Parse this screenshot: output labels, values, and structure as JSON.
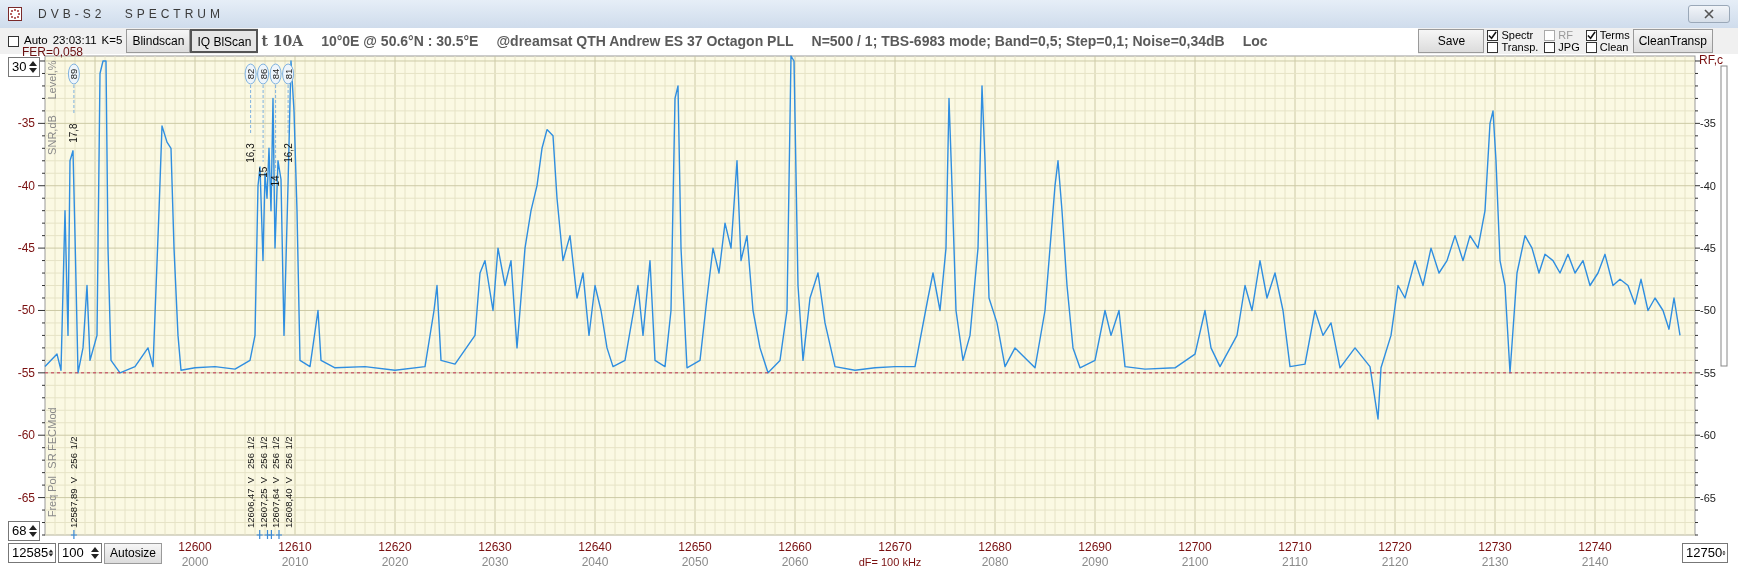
{
  "window": {
    "title": "DVB-S2 SPECTRUM"
  },
  "toolbar": {
    "auto": {
      "label": "Auto",
      "checked": false
    },
    "clock": "23:03:11",
    "k": "K=5",
    "buttons": [
      {
        "label": "Blindscan",
        "default": false
      },
      {
        "label": "IQ BlScan",
        "default": true
      }
    ],
    "info": [
      "t 10A",
      "10°0E  @  50.6°N : 30.5°E",
      "@dreamsat QTH Andrew ES 37 Octagon PLL",
      "N=500 / 1; TBS-6983 mode; Band=0,5; Step=0,1; Noise=0,34dB",
      "Loc"
    ],
    "save": "Save",
    "options": [
      {
        "label": "Spectr",
        "checked": true,
        "disabled": false
      },
      {
        "label": "Transp.",
        "checked": false,
        "disabled": false
      },
      {
        "label": "RF",
        "checked": false,
        "disabled": true
      },
      {
        "label": "JPG",
        "checked": false,
        "disabled": false
      },
      {
        "label": "Terms",
        "checked": true,
        "disabled": false
      },
      {
        "label": "Clean",
        "checked": false,
        "disabled": false
      }
    ],
    "clean_button": "CleanTransp"
  },
  "fer": "FER=0,058",
  "controls": {
    "top_level": "30",
    "bottom_level": "68",
    "start": "12585",
    "span": "100",
    "autosize": "Autosize",
    "end": "12750"
  },
  "chart": {
    "left_captions_top": [
      "Level,%",
      "SNR,dB"
    ],
    "left_captions_bottom": [
      "Mod",
      "FEC",
      "SR",
      "Pol",
      "Freq"
    ],
    "right_caption": "RF,c",
    "right_labels": [
      "-35",
      "-40",
      "-45",
      "-50",
      "-55",
      "-60",
      "-65"
    ],
    "if_row": [
      {
        "text": "2000",
        "kind": "if"
      },
      {
        "text": "2010",
        "kind": "if"
      },
      {
        "text": "2020",
        "kind": "if"
      },
      {
        "text": "2030",
        "kind": "if"
      },
      {
        "text": "2040",
        "kind": "if"
      },
      {
        "text": "2050",
        "kind": "if"
      },
      {
        "text": "2060",
        "kind": "if"
      },
      {
        "text": "dF= 100 kHz",
        "kind": "step"
      },
      {
        "text": "2080",
        "kind": "if"
      },
      {
        "text": "2090",
        "kind": "if"
      },
      {
        "text": "2100",
        "kind": "if"
      },
      {
        "text": "2110",
        "kind": "if"
      },
      {
        "text": "2120",
        "kind": "if"
      },
      {
        "text": "2130",
        "kind": "if"
      },
      {
        "text": "2140",
        "kind": "if"
      }
    ],
    "chart_data": {
      "type": "line",
      "xlim": [
        12585,
        12750
      ],
      "ylim": [
        -68,
        -29.6
      ],
      "grid": true,
      "xticks": [
        12600,
        12610,
        12620,
        12630,
        12640,
        12650,
        12660,
        12670,
        12680,
        12690,
        12700,
        12710,
        12720,
        12730,
        12740
      ],
      "yticks": [
        {
          "value": -35,
          "label": "-35"
        },
        {
          "value": -40,
          "label": "-40"
        },
        {
          "value": -45,
          "label": "-45"
        },
        {
          "value": -50,
          "label": "-50"
        },
        {
          "value": -55,
          "label": "-55"
        },
        {
          "value": -60,
          "label": "-60"
        },
        {
          "value": -65,
          "label": "-65"
        }
      ],
      "x": [
        12585,
        12586.2,
        12586.6,
        12587,
        12587.3,
        12587.5,
        12587.8,
        12588,
        12588.3,
        12588.8,
        12589.2,
        12589.5,
        12590.2,
        12590.5,
        12590.8,
        12591.1,
        12591.3,
        12591.6,
        12592.5,
        12594,
        12595.3,
        12595.8,
        12596.4,
        12596.7,
        12597.2,
        12597.6,
        12597.9,
        12598.3,
        12598.6,
        12600,
        12602,
        12604,
        12605.5,
        12606,
        12606.3,
        12606.5,
        12606.8,
        12607,
        12607.2,
        12607.4,
        12607.6,
        12607.8,
        12608,
        12608.3,
        12608.6,
        12608.9,
        12609.3,
        12609.6,
        12609.9,
        12610.2,
        12610.5,
        12611.5,
        12612.3,
        12612.6,
        12614,
        12617,
        12620,
        12623,
        12623.9,
        12624.2,
        12624.6,
        12626,
        12628,
        12628.5,
        12629,
        12629.8,
        12630.3,
        12631,
        12631.6,
        12632.2,
        12633,
        12633.6,
        12634.2,
        12634.7,
        12635.2,
        12635.8,
        12636.2,
        12636.8,
        12637.5,
        12638.2,
        12638.8,
        12639.4,
        12640,
        12640.6,
        12641.2,
        12641.8,
        12643,
        12644.3,
        12644.8,
        12645.5,
        12646,
        12647,
        12647.6,
        12648,
        12648.3,
        12648.6,
        12649.2,
        12650.5,
        12651.2,
        12651.8,
        12652.4,
        12653,
        12653.6,
        12654.2,
        12654.6,
        12655.2,
        12655.8,
        12656.5,
        12657.3,
        12658.5,
        12659.2,
        12659.6,
        12659.9,
        12660.3,
        12660.8,
        12661.5,
        12662.3,
        12663,
        12664,
        12666,
        12668,
        12670,
        12672,
        12673.3,
        12673.8,
        12674.5,
        12675.1,
        12675.4,
        12675.7,
        12676.1,
        12676.8,
        12677.5,
        12678.3,
        12678.7,
        12679,
        12679.4,
        12680.2,
        12681,
        12682,
        12684,
        12685,
        12685.6,
        12686,
        12686.3,
        12686.7,
        12687.2,
        12687.8,
        12688.5,
        12690,
        12691,
        12691.6,
        12692.4,
        12693,
        12695,
        12698,
        12700,
        12701,
        12701.6,
        12702.5,
        12704.2,
        12705,
        12705.7,
        12706.5,
        12707.2,
        12708,
        12708.8,
        12709.5,
        12711,
        12712,
        12712.8,
        12713.6,
        12714.5,
        12716,
        12717.5,
        12718.3,
        12718.6,
        12719.6,
        12720.3,
        12721,
        12722,
        12722.8,
        12723.6,
        12724.4,
        12725.2,
        12726,
        12726.8,
        12727.5,
        12728.3,
        12729,
        12729.5,
        12729.8,
        12730.1,
        12730.5,
        12731,
        12731.5,
        12732.2,
        12733,
        12733.7,
        12734.4,
        12735,
        12735.8,
        12736.5,
        12737.3,
        12738,
        12738.8,
        12739.5,
        12740.3,
        12741,
        12741.8,
        12742.5,
        12743.3,
        12744,
        12744.6,
        12745.3,
        12746,
        12746.8,
        12747.4,
        12747.9,
        12748.5
      ],
      "series": [
        {
          "color": "#2f8ee0",
          "values": [
            -54.5,
            -53.5,
            -54.8,
            -42,
            -52,
            -38,
            -37.2,
            -44,
            -55,
            -53,
            -48,
            -54,
            -52,
            -31,
            -30,
            -30,
            -45,
            -54,
            -55,
            -54.5,
            -53,
            -54.5,
            -42,
            -35.2,
            -36.5,
            -37,
            -45,
            -52,
            -54.8,
            -54.6,
            -54.5,
            -54.7,
            -54,
            -52,
            -40,
            -38.5,
            -46,
            -39,
            -41,
            -37,
            -42,
            -33,
            -45,
            -38,
            -39.5,
            -52,
            -40,
            -30,
            -34,
            -42,
            -54,
            -54.5,
            -50,
            -54,
            -54.6,
            -54.5,
            -54.8,
            -54.5,
            -50,
            -48,
            -54,
            -54.3,
            -52,
            -47,
            -46,
            -50,
            -45,
            -48,
            -46,
            -53,
            -45,
            -42,
            -40,
            -37,
            -35.5,
            -36,
            -41,
            -46,
            -44,
            -49,
            -47,
            -52,
            -48,
            -50,
            -53,
            -54.5,
            -54,
            -48,
            -52,
            -46,
            -54,
            -54.5,
            -50,
            -33,
            -32,
            -45,
            -54.6,
            -54,
            -49,
            -45,
            -47,
            -43,
            -45,
            -38,
            -46,
            -44,
            -50,
            -53,
            -55,
            -54,
            -50,
            -29.6,
            -30,
            -48,
            -54,
            -49,
            -47,
            -51,
            -54.5,
            -54.8,
            -54.6,
            -54.5,
            -54.5,
            -49,
            -47,
            -50,
            -45,
            -33,
            -40,
            -50,
            -54,
            -52,
            -45,
            -32,
            -38,
            -49,
            -51,
            -54.5,
            -53,
            -54.6,
            -50,
            -44,
            -40,
            -38,
            -42,
            -48,
            -53,
            -54.6,
            -54,
            -50,
            -52,
            -50,
            -54.5,
            -54.7,
            -54.6,
            -53.5,
            -50,
            -53,
            -54.5,
            -52,
            -48,
            -50,
            -46,
            -49,
            -47,
            -50,
            -54.5,
            -54.3,
            -50,
            -52,
            -51,
            -54.6,
            -53,
            -54.5,
            -58.7,
            -54.6,
            -52,
            -48,
            -49,
            -46,
            -48,
            -45,
            -47,
            -46,
            -44,
            -46,
            -44,
            -45,
            -42,
            -35,
            -34,
            -38,
            -46,
            -48,
            -55,
            -47,
            -44,
            -45,
            -47,
            -45.5,
            -46,
            -47,
            -45.5,
            -47,
            -46,
            -48,
            -47,
            -45.5,
            -48,
            -47.5,
            -48,
            -49.5,
            -47.5,
            -50,
            -49,
            -50,
            -51.5,
            -49,
            -52
          ]
        }
      ],
      "ref_lines": [
        {
          "axis": "y",
          "value": -55
        }
      ],
      "annotations": [
        {
          "x": 12587.89,
          "y": -36.8,
          "text": "17,8"
        },
        {
          "x": 12606.47,
          "y": -38.4,
          "text": "16,3"
        },
        {
          "x": 12607.25,
          "y": -39.6,
          "text": "15"
        },
        {
          "x": 12607.64,
          "y": -40.3,
          "text": "14"
        },
        {
          "x": 12608.4,
          "y": -38.4,
          "text": "16,2"
        }
      ]
    },
    "transponders": [
      {
        "level": "89",
        "pol": "V",
        "sr": "256",
        "fec": "1/2",
        "freq": "12587,89"
      },
      {
        "level": "82",
        "pol": "V",
        "sr": "256",
        "fec": "1/2",
        "freq": "12606,47"
      },
      {
        "level": "86",
        "pol": "V",
        "sr": "256",
        "fec": "1/2",
        "freq": "12607,25"
      },
      {
        "level": "84",
        "pol": "V",
        "sr": "256",
        "fec": "1/2",
        "freq": "12607,64"
      },
      {
        "level": "81",
        "pol": "V",
        "sr": "256",
        "fec": "1/2",
        "freq": "12608,40"
      }
    ]
  }
}
